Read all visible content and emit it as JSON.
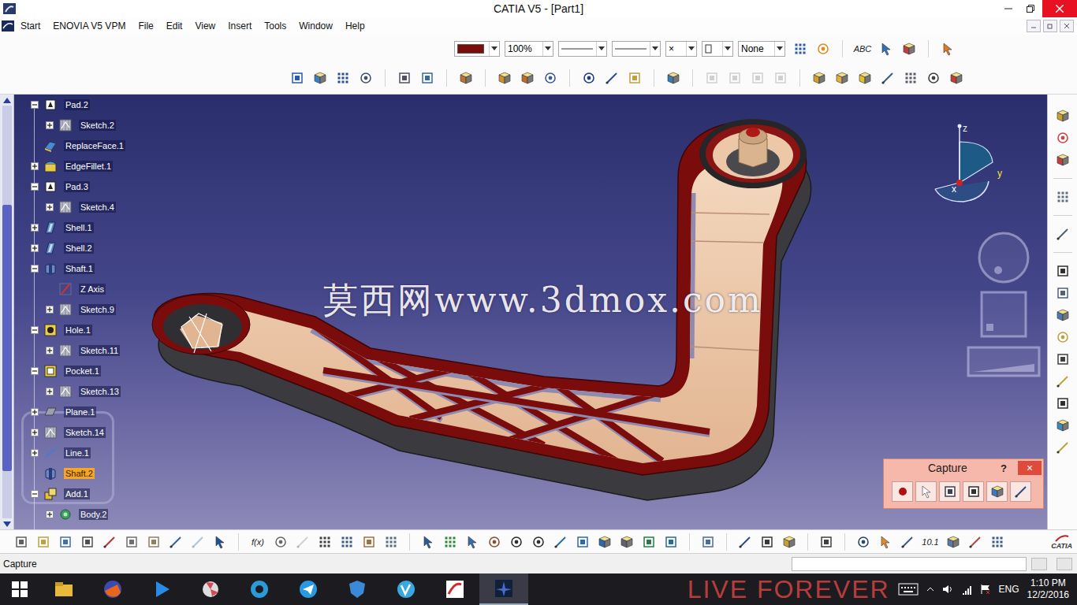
{
  "window": {
    "title": "CATIA V5 - [Part1]"
  },
  "menu": {
    "items": [
      "Start",
      "ENOVIA V5 VPM",
      "File",
      "Edit",
      "View",
      "Insert",
      "Tools",
      "Window",
      "Help"
    ]
  },
  "toolbar": {
    "color": "#7b0c0c",
    "zoom": "100%",
    "symbol": "×",
    "layer": "None",
    "text_icon": "ABC",
    "formula_icon": "f(x)",
    "number_icon": "10.1"
  },
  "tree": {
    "items": [
      {
        "label": "Pad.2",
        "level": 0,
        "toggle": "open",
        "kind": "pad",
        "selected": false
      },
      {
        "label": "Sketch.2",
        "level": 1,
        "toggle": "closed",
        "kind": "sketch",
        "selected": false
      },
      {
        "label": "ReplaceFace.1",
        "level": 0,
        "toggle": "none",
        "kind": "face",
        "selected": false
      },
      {
        "label": "EdgeFillet.1",
        "level": 0,
        "toggle": "closed",
        "kind": "fillet",
        "selected": false
      },
      {
        "label": "Pad.3",
        "level": 0,
        "toggle": "open",
        "kind": "pad",
        "selected": false
      },
      {
        "label": "Sketch.4",
        "level": 1,
        "toggle": "closed",
        "kind": "sketch",
        "selected": false
      },
      {
        "label": "Shell.1",
        "level": 0,
        "toggle": "closed",
        "kind": "shell",
        "selected": false
      },
      {
        "label": "Shell.2",
        "level": 0,
        "toggle": "closed",
        "kind": "shell",
        "selected": false
      },
      {
        "label": "Shaft.1",
        "level": 0,
        "toggle": "open",
        "kind": "shaft",
        "selected": false
      },
      {
        "label": "Z Axis",
        "level": 1,
        "toggle": "none",
        "kind": "axis",
        "selected": false
      },
      {
        "label": "Sketch.9",
        "level": 1,
        "toggle": "closed",
        "kind": "sketch",
        "selected": false
      },
      {
        "label": "Hole.1",
        "level": 0,
        "toggle": "open",
        "kind": "hole",
        "selected": false
      },
      {
        "label": "Sketch.11",
        "level": 1,
        "toggle": "closed",
        "kind": "sketch",
        "selected": false
      },
      {
        "label": "Pocket.1",
        "level": 0,
        "toggle": "open",
        "kind": "pocket",
        "selected": false
      },
      {
        "label": "Sketch.13",
        "level": 1,
        "toggle": "closed",
        "kind": "sketch",
        "selected": false
      },
      {
        "label": "Plane.1",
        "level": 0,
        "toggle": "closed",
        "kind": "plane",
        "selected": false
      },
      {
        "label": "Sketch.14",
        "level": 0,
        "toggle": "closed",
        "kind": "sketch",
        "selected": false
      },
      {
        "label": "Line.1",
        "level": 0,
        "toggle": "closed",
        "kind": "line",
        "selected": false
      },
      {
        "label": "Shaft.2",
        "level": 0,
        "toggle": "none",
        "kind": "shaft",
        "selected": true
      },
      {
        "label": "Add.1",
        "level": 0,
        "toggle": "open",
        "kind": "add",
        "selected": false
      },
      {
        "label": "Body.2",
        "level": 1,
        "toggle": "closed",
        "kind": "body",
        "selected": false
      }
    ]
  },
  "viewer": {
    "watermark": "莫西网www.3dmox.com",
    "compass_axes": [
      "z",
      "y",
      "x"
    ]
  },
  "capture": {
    "title": "Capture",
    "help": "?",
    "close": "×"
  },
  "status_bar": {
    "text": "Capture"
  },
  "logo": "CATIA",
  "taskbar": {
    "wallpaper_text": "LIVE FOREVER",
    "language": "ENG",
    "time": "1:10 PM",
    "date": "12/2/2016"
  }
}
